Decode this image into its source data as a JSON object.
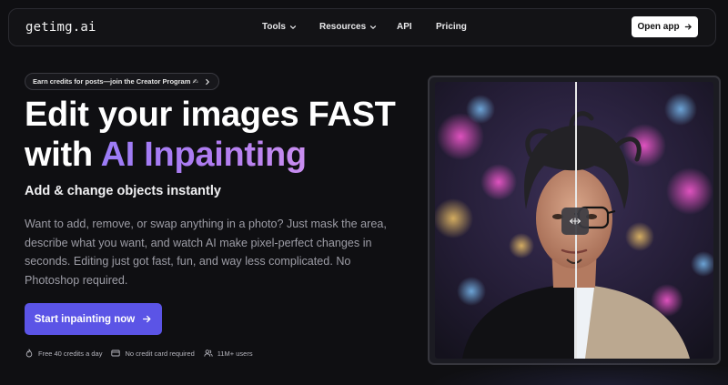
{
  "brand": {
    "logo": "getimg.ai"
  },
  "nav": {
    "links": [
      {
        "label": "Tools",
        "has_dropdown": true
      },
      {
        "label": "Resources",
        "has_dropdown": true
      },
      {
        "label": "API",
        "has_dropdown": false
      },
      {
        "label": "Pricing",
        "has_dropdown": false
      }
    ],
    "open_app": "Open app"
  },
  "promo": {
    "text": "Earn credits for posts—join the Creator Program ✍"
  },
  "hero": {
    "headline_line1": "Edit your images FAST",
    "headline_with": "with ",
    "headline_accent": "AI Inpainting",
    "subhead": "Add & change objects instantly",
    "description": "Want to add, remove, or swap anything in a photo? Just mask the area, describe what you want, and watch AI make pixel-perfect changes in seconds. Editing just got fast, fun, and way less complicated. No Photoshop required.",
    "cta": "Start inpainting now"
  },
  "perks": [
    {
      "icon": "flame-icon",
      "text": "Free 40 credits a day"
    },
    {
      "icon": "credit-card-icon",
      "text": "No credit card required"
    },
    {
      "icon": "users-icon",
      "text": "11M+ users"
    }
  ],
  "colors": {
    "background": "#0f0f12",
    "accent": "#5b54e6",
    "accent_text_gradient": [
      "#9b7cf7",
      "#c98ef0"
    ],
    "muted_text": "#9d9da6"
  }
}
